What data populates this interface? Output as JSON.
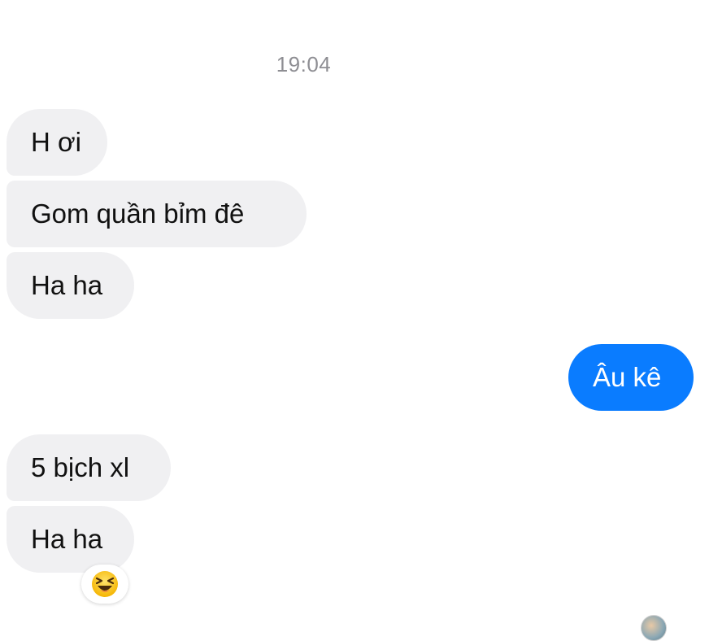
{
  "conversation": {
    "timestamp": "19:04",
    "messages": [
      {
        "direction": "received",
        "text": "H ơi"
      },
      {
        "direction": "received",
        "text": "Gom quần bỉm đê"
      },
      {
        "direction": "received",
        "text": "Ha ha"
      },
      {
        "direction": "sent",
        "text": "Âu kê"
      },
      {
        "direction": "received",
        "text": "5 bịch xl"
      },
      {
        "direction": "received",
        "text": "Ha ha"
      }
    ],
    "reaction": {
      "icon": "laughing-squint-emoji-icon"
    },
    "seen_indicator": {
      "icon": "seen-avatar-icon"
    }
  },
  "colors": {
    "sent_bubble": "#0a7cff",
    "received_bubble": "#f0f0f2",
    "timestamp_text": "#8e8e93"
  }
}
